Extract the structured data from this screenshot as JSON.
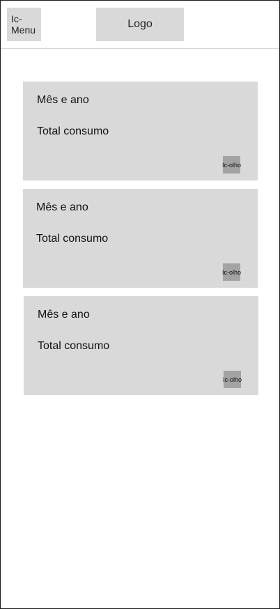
{
  "header": {
    "menu_icon_label": "Ic-Menu",
    "logo_label": "Logo"
  },
  "cards": [
    {
      "month_label": "Mês e ano",
      "total_label": "Total consumo",
      "eye_icon_label": "Ic-olho"
    },
    {
      "month_label": "Mês e ano",
      "total_label": "Total consumo",
      "eye_icon_label": "Ic-olho"
    },
    {
      "month_label": "Mês e ano",
      "total_label": "Total consumo",
      "eye_icon_label": "Ic-olho"
    }
  ]
}
